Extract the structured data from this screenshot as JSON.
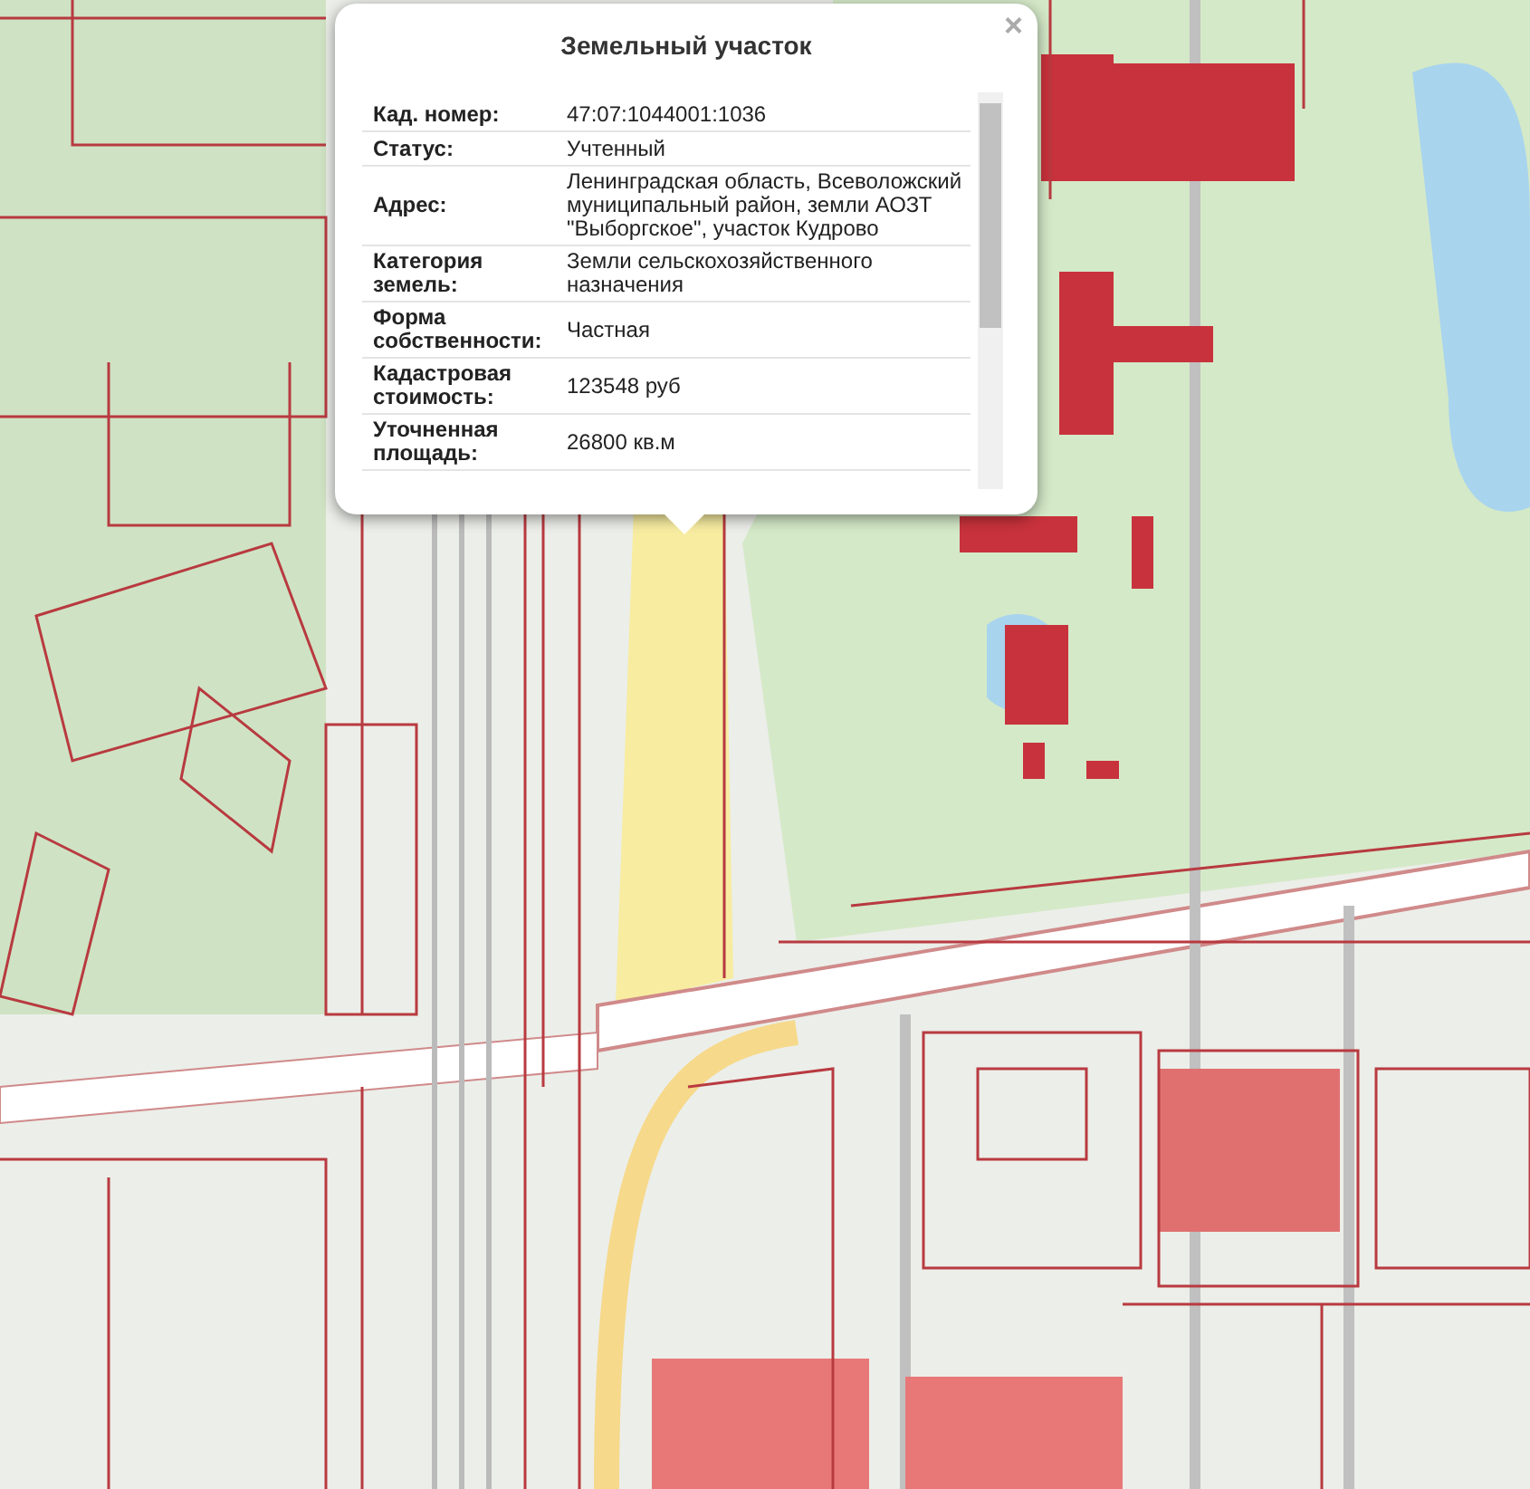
{
  "popup": {
    "title": "Земельный участок",
    "close": "×",
    "rows": [
      {
        "label": "Кад. номер:",
        "value": "47:07:1044001:1036"
      },
      {
        "label": "Статус:",
        "value": "Учтенный"
      },
      {
        "label": "Адрес:",
        "value": "Ленинградская область, Всеволожский муниципальный район, земли АОЗТ \"Выборгское\", участок Кудрово"
      },
      {
        "label": "Категория земель:",
        "value": "Земли сельскохозяйственного назначения"
      },
      {
        "label": "Форма собственности:",
        "value": "Частная"
      },
      {
        "label": "Кадастровая стоимость:",
        "value": "123548 руб"
      },
      {
        "label": "Уточненная площадь:",
        "value": "26800 кв.м"
      }
    ]
  }
}
